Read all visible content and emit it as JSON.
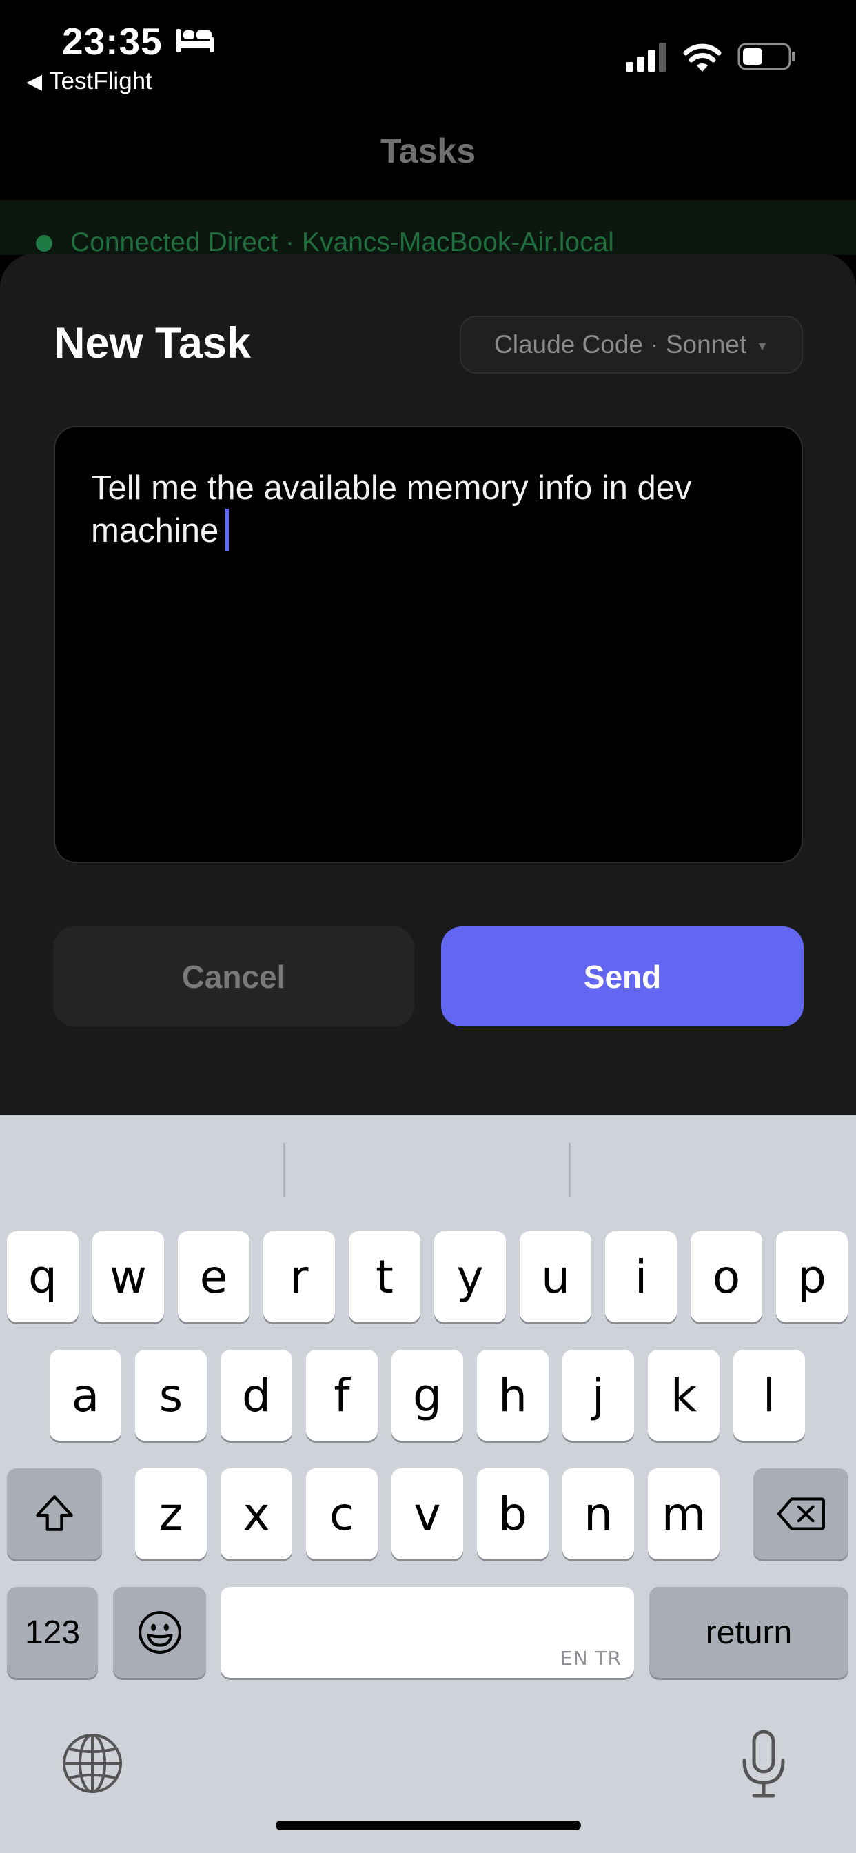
{
  "status_bar": {
    "time": "23:35",
    "back_app": "TestFlight"
  },
  "nav": {
    "title": "Tasks"
  },
  "connection": {
    "text": "Connected Direct · Kvancs-MacBook-Air.local",
    "status_color": "#1f7a43"
  },
  "sheet": {
    "title": "New Task",
    "model_selector": "Claude Code · Sonnet",
    "task_text": "Tell me the available memory info in dev machine",
    "cancel_label": "Cancel",
    "send_label": "Send",
    "accent_color": "#6366f1"
  },
  "keyboard": {
    "row1": [
      "q",
      "w",
      "e",
      "r",
      "t",
      "y",
      "u",
      "i",
      "o",
      "p"
    ],
    "row2": [
      "a",
      "s",
      "d",
      "f",
      "g",
      "h",
      "j",
      "k",
      "l"
    ],
    "row3": [
      "z",
      "x",
      "c",
      "v",
      "b",
      "n",
      "m"
    ],
    "numbers_key": "123",
    "return_key": "return",
    "space_languages": "EN TR",
    "icons": [
      "shift-icon",
      "delete-icon",
      "emoji-icon",
      "globe-icon",
      "microphone-icon"
    ]
  }
}
